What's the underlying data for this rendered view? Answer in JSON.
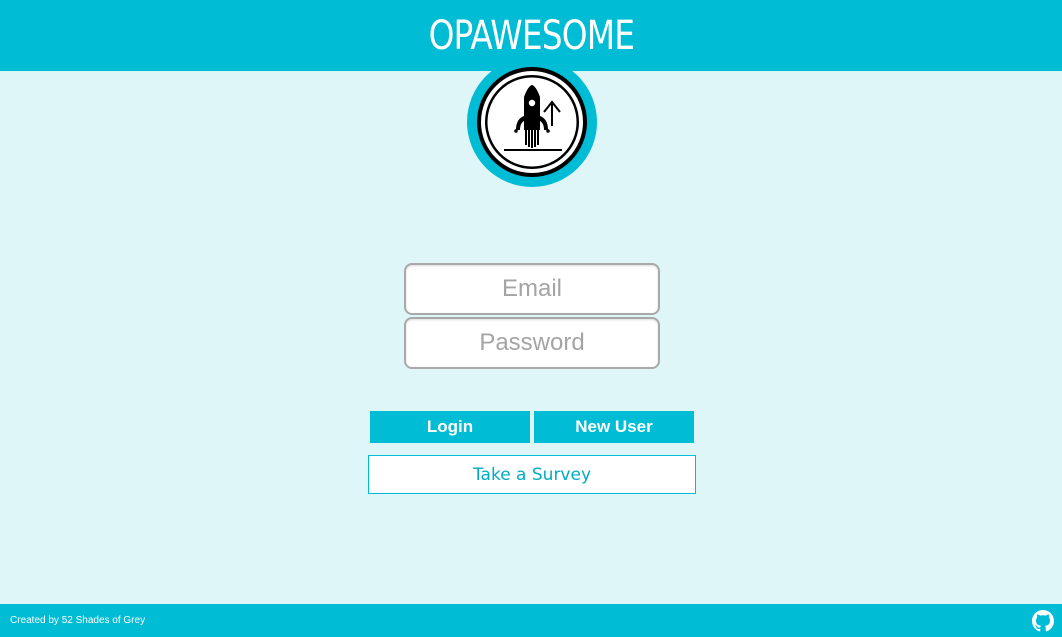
{
  "header": {
    "title": "OPAWESOME"
  },
  "logo": {
    "icon": "rocket-launch-icon"
  },
  "login_form": {
    "email": {
      "placeholder": "Email",
      "value": ""
    },
    "password": {
      "placeholder": "Password",
      "value": ""
    }
  },
  "buttons": {
    "login_label": "Login",
    "new_user_label": "New User",
    "survey_label": "Take a Survey"
  },
  "footer": {
    "credit": "Created by 52 Shades of Grey",
    "github_icon": "github-icon"
  },
  "colors": {
    "accent": "#00bcd4",
    "background": "#dff6f8",
    "survey_text": "#00acc1"
  }
}
